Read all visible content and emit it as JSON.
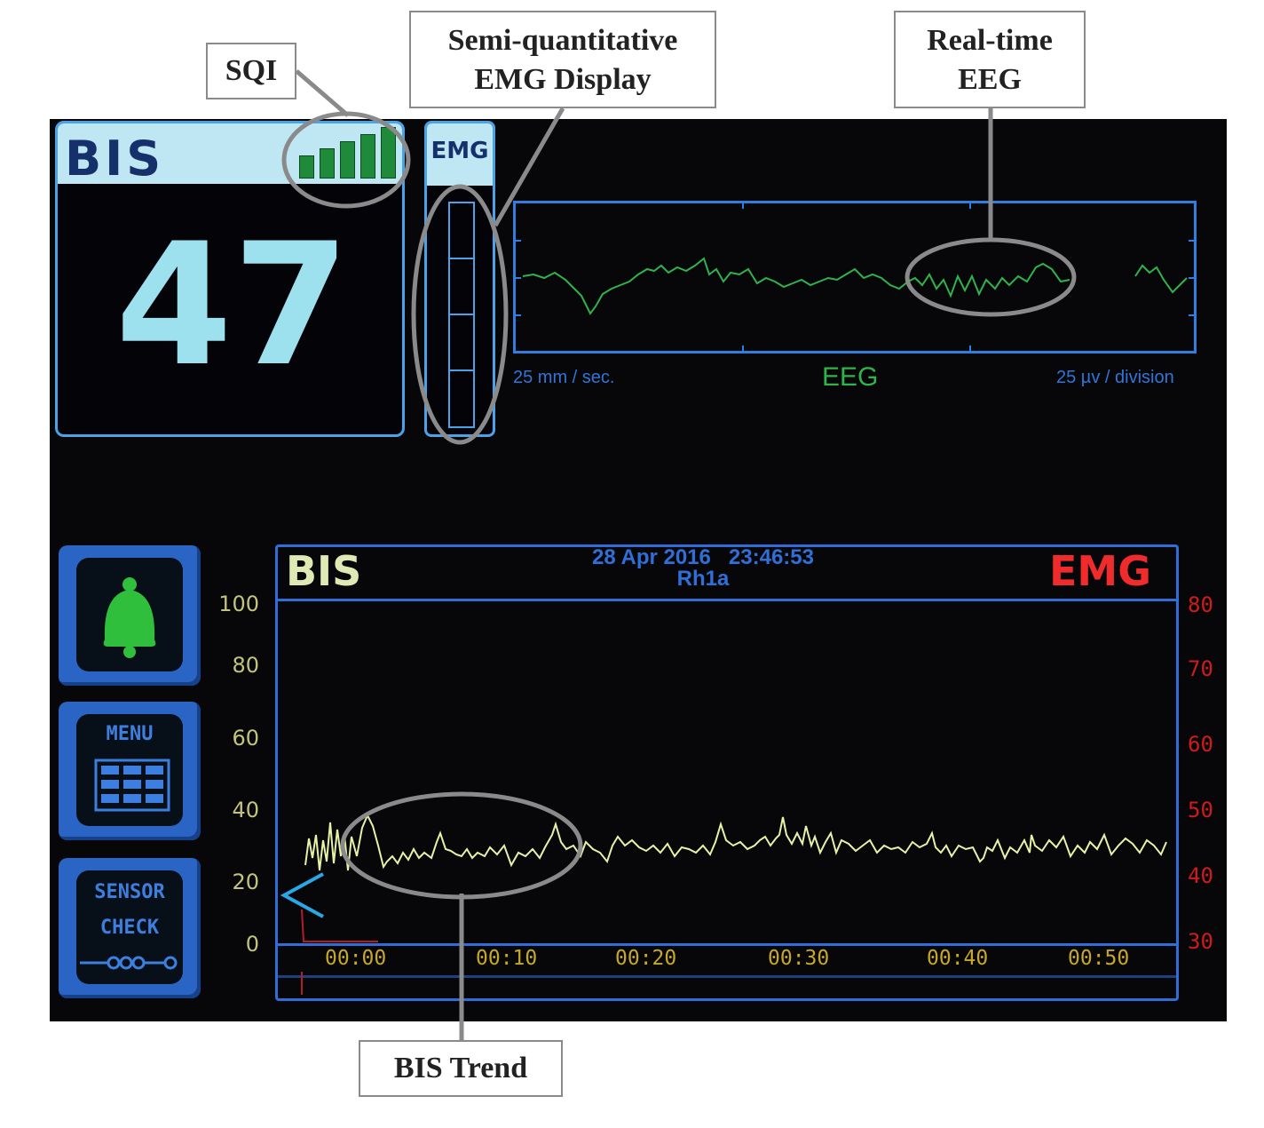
{
  "callouts": {
    "sqi": "SQI",
    "emg_display_line1": "Semi-quantitative",
    "emg_display_line2": "EMG Display",
    "eeg_line1": "Real-time",
    "eeg_line2": "EEG",
    "bis_trend": "BIS Trend"
  },
  "bis_panel": {
    "title": "BIS",
    "value": "47",
    "sqi_level": 5,
    "sqi_level_max": 5,
    "colors": {
      "header": "#bfe6f3",
      "value": "#9de0ee",
      "sqi_bar": "#1f8a3a"
    }
  },
  "emg_panel": {
    "label": "EMG"
  },
  "eeg": {
    "label": "EEG",
    "speed": "25 mm / sec.",
    "scale": "25 µv / division",
    "color": "#2fb34a"
  },
  "side_buttons": {
    "alarm_icon": "bell-icon",
    "menu_label": "MENU",
    "menu_icon": "grid-icon",
    "sensor_line1": "SENSOR",
    "sensor_line2": "CHECK",
    "sensor_icon": "sensor-chain-icon"
  },
  "trend": {
    "title": "BIS",
    "date": "28 Apr 2016",
    "time": "23:46:53",
    "patient": "Rh1a",
    "emg_title": "EMG",
    "left_axis": [
      "100",
      "80",
      "60",
      "40",
      "20",
      "0"
    ],
    "right_axis": [
      "80",
      "70",
      "60",
      "50",
      "40",
      "30"
    ],
    "time_axis": [
      "00:00",
      "00:10",
      "00:20",
      "00:30",
      "00:40",
      "00:50"
    ],
    "colors": {
      "bis_line": "#e7f2a6",
      "emg_axis": "#d01b1b",
      "frame": "#2f6ed8"
    }
  }
}
